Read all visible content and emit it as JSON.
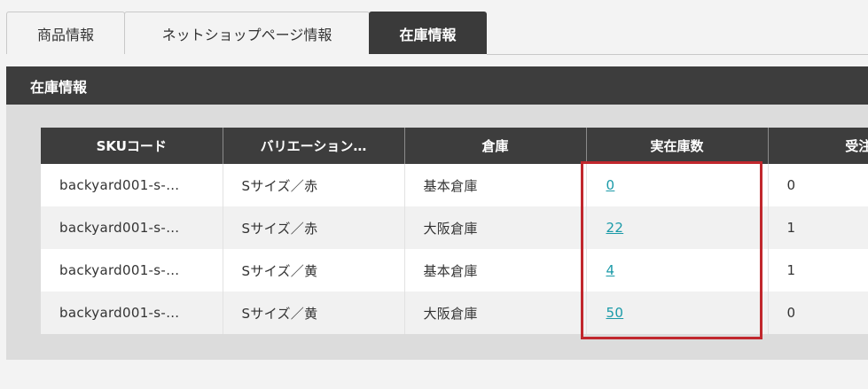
{
  "tabs": [
    {
      "label": "商品情報",
      "active": false
    },
    {
      "label": "ネットショップページ情報",
      "active": false
    },
    {
      "label": "在庫情報",
      "active": true
    }
  ],
  "section": {
    "title": "在庫情報"
  },
  "table": {
    "headers": [
      "SKUコード",
      "バリエーション…",
      "倉庫",
      "実在庫数",
      "受注"
    ],
    "rows": [
      {
        "sku": "backyard001-s-…",
        "variation": "Sサイズ／赤",
        "warehouse": "基本倉庫",
        "stock": "0",
        "orders": "0"
      },
      {
        "sku": "backyard001-s-…",
        "variation": "Sサイズ／赤",
        "warehouse": "大阪倉庫",
        "stock": "22",
        "orders": "1"
      },
      {
        "sku": "backyard001-s-…",
        "variation": "Sサイズ／黄",
        "warehouse": "基本倉庫",
        "stock": "4",
        "orders": "1"
      },
      {
        "sku": "backyard001-s-…",
        "variation": "Sサイズ／黄",
        "warehouse": "大阪倉庫",
        "stock": "50",
        "orders": "0"
      }
    ]
  },
  "colors": {
    "header_bg": "#3d3d3d",
    "link": "#1a9aa8",
    "highlight": "#c1272d"
  }
}
